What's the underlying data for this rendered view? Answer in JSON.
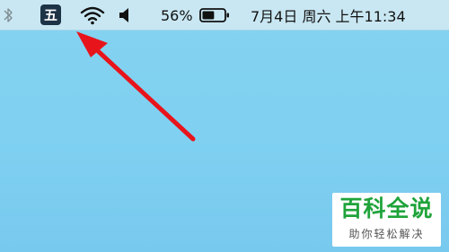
{
  "menubar": {
    "icons": {
      "bluetooth": "bluetooth-icon",
      "wifi": "wifi-icon",
      "volume": "volume-icon",
      "battery": "battery-icon"
    },
    "input_method_label": "五",
    "battery_percent": "56%",
    "battery_level": 0.56,
    "datetime": "7月4日 周六 上午11:34"
  },
  "watermark": {
    "title": "百科全说",
    "subtitle": "助你轻松解决"
  },
  "annotation": {
    "arrow_color": "#e8141b"
  }
}
